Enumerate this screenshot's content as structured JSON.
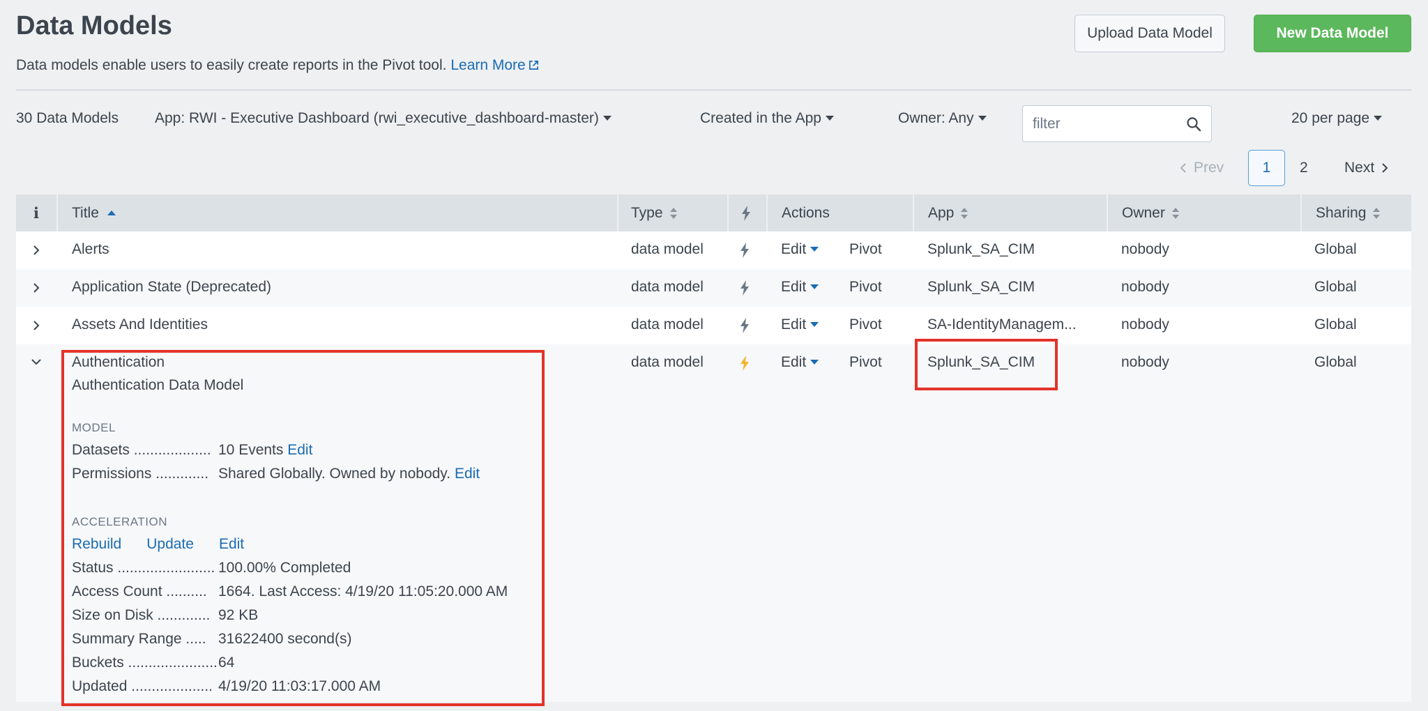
{
  "header": {
    "title": "Data Models",
    "subtitle": "Data models enable users to easily create reports in the Pivot tool.",
    "learn_more": "Learn More",
    "upload_button": "Upload Data Model",
    "new_button": "New Data Model"
  },
  "filters": {
    "count": "30 Data Models",
    "app": "App: RWI - Executive Dashboard (rwi_executive_dashboard-master)",
    "created": "Created in the App",
    "owner": "Owner: Any",
    "search_placeholder": "filter",
    "per_page": "20 per page"
  },
  "pagination": {
    "prev": "Prev",
    "pages": [
      "1",
      "2"
    ],
    "current": "1",
    "next": "Next"
  },
  "table": {
    "columns": {
      "info": "i",
      "title": "Title",
      "type": "Type",
      "actions": "Actions",
      "app": "App",
      "owner": "Owner",
      "sharing": "Sharing"
    },
    "rows": [
      {
        "title": "Alerts",
        "type": "data model",
        "edit": "Edit",
        "pivot": "Pivot",
        "app": "Splunk_SA_CIM",
        "owner": "nobody",
        "sharing": "Global",
        "accelerated": false
      },
      {
        "title": "Application State (Deprecated)",
        "type": "data model",
        "edit": "Edit",
        "pivot": "Pivot",
        "app": "Splunk_SA_CIM",
        "owner": "nobody",
        "sharing": "Global",
        "accelerated": false
      },
      {
        "title": "Assets And Identities",
        "type": "data model",
        "edit": "Edit",
        "pivot": "Pivot",
        "app": "SA-IdentityManagem...",
        "owner": "nobody",
        "sharing": "Global",
        "accelerated": false
      },
      {
        "title": "Authentication",
        "type": "data model",
        "edit": "Edit",
        "pivot": "Pivot",
        "app": "Splunk_SA_CIM",
        "owner": "nobody",
        "sharing": "Global",
        "accelerated": true
      }
    ]
  },
  "details": {
    "description": "Authentication Data Model",
    "model_label": "MODEL",
    "datasets_label": "Datasets ...................",
    "datasets_value": "10 Events",
    "permissions_label": "Permissions .............",
    "permissions_value": "Shared Globally. Owned by nobody.",
    "edit_link": "Edit",
    "acceleration_label": "ACCELERATION",
    "rebuild": "Rebuild",
    "update": "Update",
    "edit": "Edit",
    "status_label": "Status ........................",
    "status_value": "100.00% Completed",
    "access_label": "Access Count ..........",
    "access_value": "1664. Last Access: 4/19/20 11:05:20.000 AM",
    "size_label": "Size on Disk .............",
    "size_value": "92 KB",
    "range_label": "Summary Range .....",
    "range_value": "31622400 second(s)",
    "buckets_label": "Buckets ......................",
    "buckets_value": "64",
    "updated_label": "Updated ....................",
    "updated_value": "4/19/20 11:03:17.000 AM"
  },
  "colors": {
    "link": "#1a6bb3",
    "primary_button": "#5cb85c",
    "highlight": "#e2332a",
    "accelerated_bolt": "#f5b330"
  }
}
